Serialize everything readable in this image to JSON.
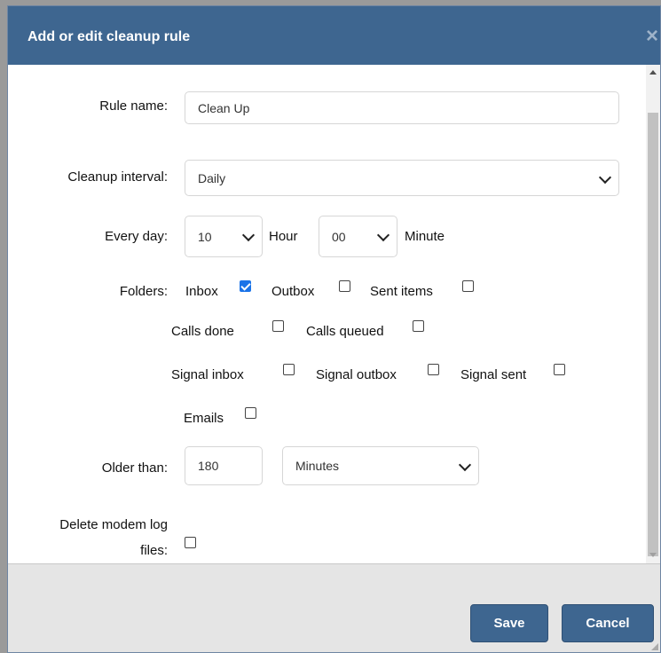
{
  "dialog": {
    "title": "Add or edit cleanup rule",
    "close_icon": "×"
  },
  "form": {
    "rule_name": {
      "label": "Rule name:",
      "value": "Clean Up"
    },
    "cleanup_interval": {
      "label": "Cleanup interval:",
      "value": "Daily"
    },
    "every_day": {
      "label": "Every day:",
      "hour_value": "10",
      "hour_unit": "Hour",
      "minute_value": "00",
      "minute_unit": "Minute"
    },
    "folders": {
      "label": "Folders:",
      "items": [
        {
          "label": "Inbox",
          "checked": true
        },
        {
          "label": "Outbox",
          "checked": false
        },
        {
          "label": "Sent items",
          "checked": false
        },
        {
          "label": "Calls done",
          "checked": false
        },
        {
          "label": "Calls queued",
          "checked": false
        },
        {
          "label": "Signal inbox",
          "checked": false
        },
        {
          "label": "Signal outbox",
          "checked": false
        },
        {
          "label": "Signal sent",
          "checked": false
        },
        {
          "label": "Emails",
          "checked": false
        }
      ]
    },
    "older_than": {
      "label": "Older than:",
      "value": "180",
      "unit": "Minutes"
    },
    "delete_logs": {
      "label_line1": "Delete modem log",
      "label_line2": "files:",
      "checked": false
    }
  },
  "footer": {
    "save_label": "Save",
    "cancel_label": "Cancel"
  },
  "colors": {
    "header": "#3e6690",
    "button": "#3e6690",
    "checkbox_checked": "#1a73e8"
  }
}
